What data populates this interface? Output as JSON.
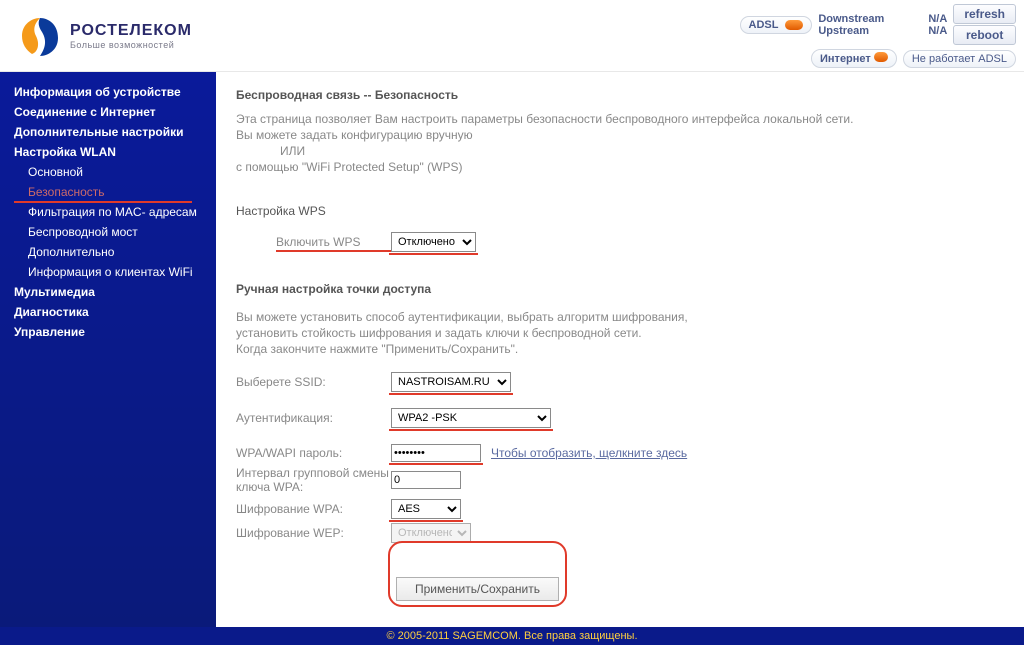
{
  "brand": {
    "name": "РОСТЕЛЕКОМ",
    "tagline": "Больше возможностей"
  },
  "status": {
    "adsl_label": "ADSL",
    "downstream_label": "Downstream",
    "upstream_label": "Upstream",
    "downstream_val": "N/A",
    "upstream_val": "N/A",
    "refresh": "refresh",
    "reboot": "reboot",
    "internet_label": "Интернет",
    "internet_status": "Не работает ADSL"
  },
  "nav": {
    "device_info": "Информация об устройстве",
    "internet_conn": "Соединение с Интернет",
    "advanced": "Дополнительные настройки",
    "wlan": "Настройка WLAN",
    "wlan_basic": "Основной",
    "wlan_security": "Безопасность",
    "wlan_mac": "Фильтрация по MAC- адресам",
    "wlan_bridge": "Беспроводной мост",
    "wlan_extra": "Дополнительно",
    "wlan_clients": "Информация о клиентах WiFi",
    "multimedia": "Мультимедиа",
    "diag": "Диагностика",
    "manage": "Управление"
  },
  "page": {
    "title": "Беспроводная связь -- Безопасность",
    "desc1": "Эта страница позволяет Вам настроить параметры безопасности беспроводного интерфейса локальной сети.",
    "desc2": "Вы можете задать конфигурацию вручную",
    "desc_or": "ИЛИ",
    "desc3": "с помощью \"WiFi Protected Setup\" (WPS)",
    "wps_section": "Настройка WPS",
    "wps_enable_label": "Включить WPS",
    "wps_enable_value": "Отключено",
    "manual_section": "Ручная настройка точки доступа",
    "manual_desc1": "Вы можете установить способ аутентификации, выбрать алгоритм шифрования,",
    "manual_desc2": "установить стойкость шифрования и задать ключи к беспроводной сети.",
    "manual_desc3": "Когда закончите нажмите \"Применить/Сохранить\".",
    "ssid_label": "Выберете SSID:",
    "ssid_value": "NASTROISAM.RU",
    "auth_label": "Аутентификация:",
    "auth_value": "WPA2 -PSK",
    "pass_label": "WPA/WAPI пароль:",
    "pass_value": "••••••••",
    "pass_hint": "Чтобы отобразить, щелкните здесь",
    "rekey_label": "Интервал групповой смены ключа WPA:",
    "rekey_value": "0",
    "wpa_enc_label": "Шифрование WPA:",
    "wpa_enc_value": "AES",
    "wep_enc_label": "Шифрование WEP:",
    "wep_enc_value": "Отключено",
    "save": "Применить/Сохранить"
  },
  "footer": "© 2005-2011 SAGEMCOM. Все права защищены."
}
